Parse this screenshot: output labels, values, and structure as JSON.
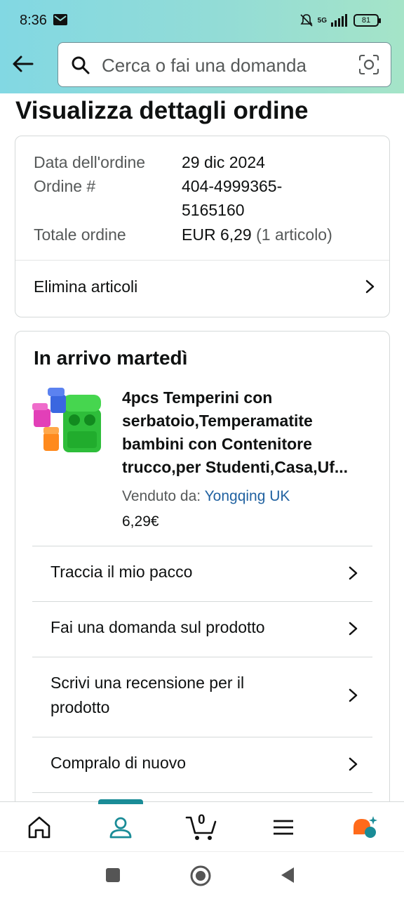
{
  "status_bar": {
    "time": "8:36",
    "network": "5G",
    "battery": "81"
  },
  "search": {
    "placeholder": "Cerca o fai una domanda"
  },
  "page": {
    "title": "Visualizza dettagli ordine"
  },
  "order_summary": {
    "date_label": "Data dell'ordine",
    "date_value": "29 dic 2024",
    "number_label": "Ordine #",
    "number_value_line1": "404-4999365-",
    "number_value_line2": "5165160",
    "total_label": "Totale ordine",
    "total_value": "EUR 6,29",
    "total_items": "(1 articolo)",
    "delete_items_label": "Elimina articoli"
  },
  "shipment": {
    "heading": "In arrivo martedì",
    "product_title": "4pcs Temperini con serbatoio,Temperamatite bambini con Contenitore trucco,per Studenti,Casa,Uf...",
    "sold_by_label": "Venduto da:",
    "seller": "Yongqing UK",
    "price": "6,29€",
    "actions": [
      {
        "label": "Traccia il mio pacco"
      },
      {
        "label": "Fai una domanda sul prodotto"
      },
      {
        "label": "Scrivi una recensione per il prodotto"
      },
      {
        "label": "Compralo di nuovo"
      }
    ]
  },
  "bottom_nav": {
    "cart_count": "0",
    "active_tab": "account",
    "accent_color": "#1a8c97"
  },
  "icons": [
    "back-arrow-icon",
    "search-icon",
    "camera-lens-icon",
    "chevron-right-icon",
    "home-icon",
    "account-icon",
    "cart-icon",
    "menu-icon",
    "rufus-assistant-icon"
  ]
}
